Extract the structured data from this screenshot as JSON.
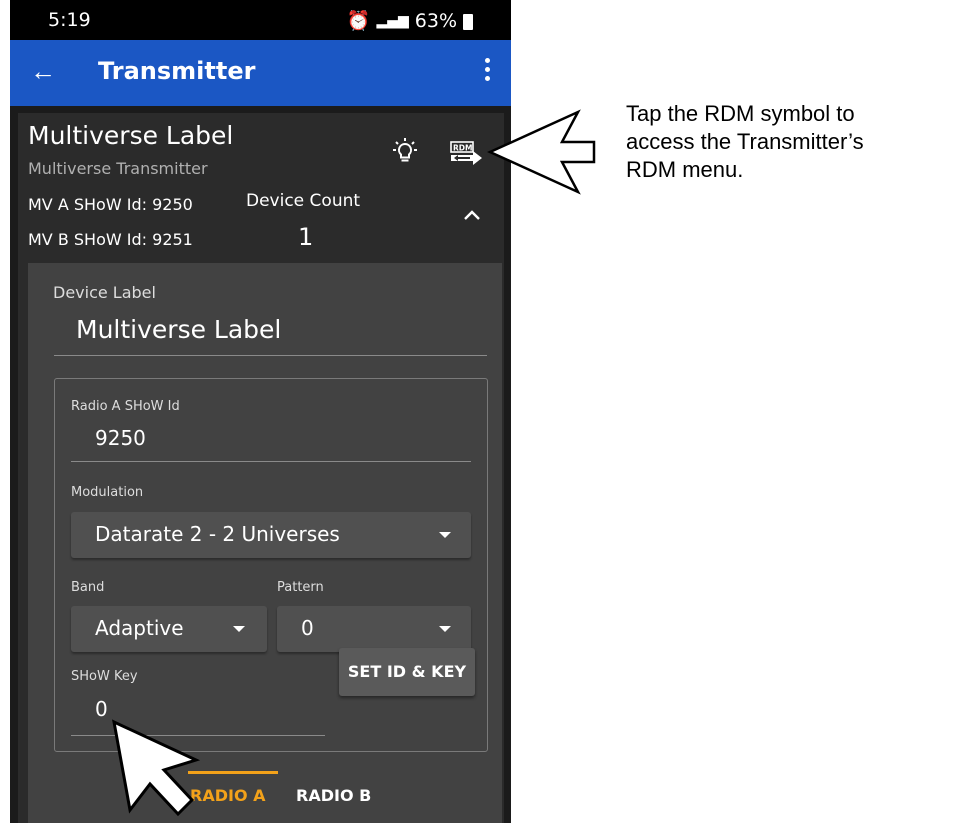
{
  "status_bar": {
    "time": "5:19",
    "battery": "63%"
  },
  "app_bar": {
    "title": "Transmitter",
    "back_icon": "arrow-left-icon",
    "menu_icon": "more-vert-icon"
  },
  "header": {
    "title": "Multiverse Label",
    "subtitle": "Multiverse Transmitter",
    "mv_a": "MV A SHoW Id: 9250",
    "mv_b": "MV B SHoW Id: 9251",
    "device_count_label": "Device Count",
    "device_count_value": "1",
    "icons": [
      "lightbulb-icon",
      "rdm-icon",
      "chevron-up-icon"
    ]
  },
  "form": {
    "device_label_label": "Device Label",
    "device_label_value": "Multiverse Label",
    "radio_showid_label": "Radio A SHoW Id",
    "radio_showid_value": "9250",
    "modulation_label": "Modulation",
    "modulation_value": "Datarate 2 - 2 Universes",
    "band_label": "Band",
    "band_value": "Adaptive",
    "pattern_label": "Pattern",
    "pattern_value": "0",
    "showkey_label": "SHoW Key",
    "showkey_value": "0",
    "set_button": "SET ID & KEY"
  },
  "tabs": {
    "radio_a": "RADIO A",
    "radio_b": "RADIO B",
    "active": "RADIO A"
  },
  "callout": "Tap the RDM symbol to\naccess the Transmitter’s\nRDM menu.",
  "colors": {
    "appbar": "#1b57c4",
    "accent": "#f3a21a",
    "card": "#2b2b2b",
    "panel": "#424242"
  }
}
